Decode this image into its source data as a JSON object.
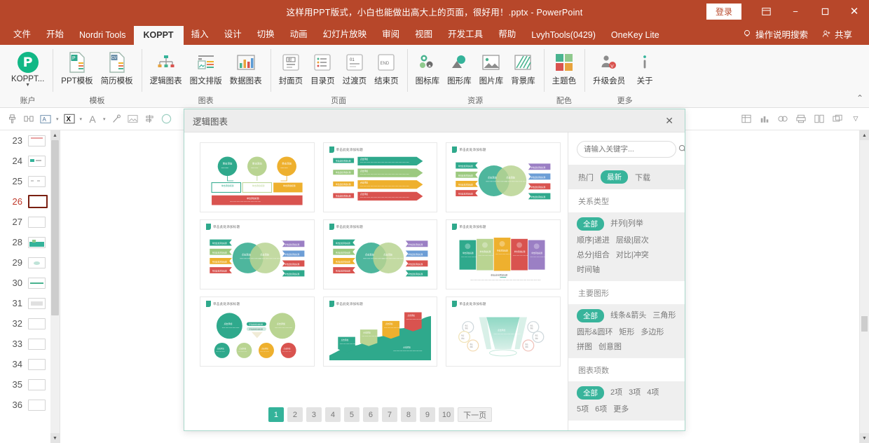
{
  "titlebar": {
    "document_title": "这样用PPT版式，小白也能做出高大上的页面，很好用！.pptx - PowerPoint",
    "signin_label": "登录",
    "restore_icon": "restore-down-icon",
    "minimize_label": "−",
    "maximize_label": "❐",
    "close_label": "✕"
  },
  "ribbon_tabs": {
    "items": [
      {
        "label": "文件",
        "active": false
      },
      {
        "label": "开始",
        "active": false
      },
      {
        "label": "Nordri Tools",
        "active": false
      },
      {
        "label": "KOPPT",
        "active": true
      },
      {
        "label": "插入",
        "active": false
      },
      {
        "label": "设计",
        "active": false
      },
      {
        "label": "切换",
        "active": false
      },
      {
        "label": "动画",
        "active": false
      },
      {
        "label": "幻灯片放映",
        "active": false
      },
      {
        "label": "审阅",
        "active": false
      },
      {
        "label": "视图",
        "active": false
      },
      {
        "label": "开发工具",
        "active": false
      },
      {
        "label": "帮助",
        "active": false
      },
      {
        "label": "LvyhTools(0429)",
        "active": false
      },
      {
        "label": "OneKey Lite",
        "active": false
      }
    ],
    "tell_me": "操作说明搜索",
    "share": "共享"
  },
  "ribbon_groups": [
    {
      "label": "账户",
      "buttons": [
        {
          "label": "KOPPT...",
          "icon": "koppt-logo-icon",
          "caret": true
        }
      ]
    },
    {
      "label": "模板",
      "buttons": [
        {
          "label": "PPT模板",
          "icon": "ppt-template-icon"
        },
        {
          "label": "简历模板",
          "icon": "resume-template-icon"
        }
      ]
    },
    {
      "label": "图表",
      "buttons": [
        {
          "label": "逻辑图表",
          "icon": "logic-chart-icon"
        },
        {
          "label": "图文排版",
          "icon": "text-image-layout-icon"
        },
        {
          "label": "数据图表",
          "icon": "data-chart-icon"
        }
      ]
    },
    {
      "label": "页面",
      "buttons": [
        {
          "label": "封面页",
          "icon": "cover-page-icon"
        },
        {
          "label": "目录页",
          "icon": "toc-page-icon"
        },
        {
          "label": "过渡页",
          "icon": "transition-page-icon"
        },
        {
          "label": "结束页",
          "icon": "end-page-icon"
        }
      ]
    },
    {
      "label": "资源",
      "buttons": [
        {
          "label": "图标库",
          "icon": "icon-library-icon"
        },
        {
          "label": "图形库",
          "icon": "shape-library-icon"
        },
        {
          "label": "图片库",
          "icon": "image-library-icon"
        },
        {
          "label": "背景库",
          "icon": "background-library-icon"
        }
      ]
    },
    {
      "label": "配色",
      "buttons": [
        {
          "label": "主题色",
          "icon": "theme-color-icon"
        }
      ]
    },
    {
      "label": "更多",
      "buttons": [
        {
          "label": "升级会员",
          "icon": "upgrade-member-icon"
        },
        {
          "label": "关于",
          "icon": "about-info-icon"
        }
      ]
    }
  ],
  "quickbar": {
    "items": [
      {
        "icon": "format-painter-icon",
        "glyph": "⎙"
      },
      {
        "icon": "duplicate-icon",
        "glyph": "◫"
      },
      {
        "icon": "text-box-icon",
        "glyph": "A"
      },
      {
        "icon": "clear-format-icon",
        "glyph": "X"
      },
      {
        "icon": "font-color-icon",
        "glyph": "A"
      },
      {
        "icon": "eyedropper-icon",
        "glyph": "✎"
      },
      {
        "icon": "picture-swap-icon",
        "glyph": "▣"
      },
      {
        "icon": "align-icon",
        "glyph": "⇹"
      },
      {
        "icon": "circle-shape-icon",
        "glyph": "◯"
      }
    ],
    "right_items": [
      {
        "icon": "table-icon",
        "glyph": "▦"
      },
      {
        "icon": "chart-bar-icon",
        "glyph": "▥"
      },
      {
        "icon": "smart-art-icon",
        "glyph": "◔"
      },
      {
        "icon": "print-icon",
        "glyph": "⎙"
      },
      {
        "icon": "columns-icon",
        "glyph": "▤"
      },
      {
        "icon": "layers-icon",
        "glyph": "▣"
      },
      {
        "icon": "more-options-icon",
        "glyph": "▽"
      }
    ]
  },
  "slide_panel": {
    "slides": [
      {
        "number": "23",
        "active": false,
        "thumb": "a"
      },
      {
        "number": "24",
        "active": false,
        "thumb": "b"
      },
      {
        "number": "25",
        "active": false,
        "thumb": "c"
      },
      {
        "number": "26",
        "active": true,
        "thumb": "d"
      },
      {
        "number": "27",
        "active": false,
        "thumb": "e"
      },
      {
        "number": "28",
        "active": false,
        "thumb": "f"
      },
      {
        "number": "29",
        "active": false,
        "thumb": "g"
      },
      {
        "number": "30",
        "active": false,
        "thumb": "h"
      },
      {
        "number": "31",
        "active": false,
        "thumb": "i"
      },
      {
        "number": "32",
        "active": false,
        "thumb": "j"
      },
      {
        "number": "33",
        "active": false,
        "thumb": "k"
      },
      {
        "number": "34",
        "active": false,
        "thumb": "l"
      },
      {
        "number": "35",
        "active": false,
        "thumb": "m"
      },
      {
        "number": "36",
        "active": false,
        "thumb": "n"
      }
    ],
    "scroll_up": "▲",
    "scroll_down": "▼"
  },
  "dialog": {
    "title": "逻辑图表",
    "close_label": "✕",
    "search": {
      "placeholder": "请输入关键字...",
      "value": "",
      "icon": "search-icon"
    },
    "sort_tabs": [
      {
        "label": "热门",
        "active": false
      },
      {
        "label": "最新",
        "active": true
      },
      {
        "label": "下载",
        "active": false
      }
    ],
    "filter_sections": [
      {
        "heading": "关系类型",
        "options": [
          {
            "label": "全部",
            "active": true
          },
          {
            "label": "并列|列举",
            "active": false
          },
          {
            "label": "顺序|递进",
            "active": false
          },
          {
            "label": "层级|层次",
            "active": false
          },
          {
            "label": "总分|组合",
            "active": false
          },
          {
            "label": "对比|冲突",
            "active": false
          },
          {
            "label": "时间轴",
            "active": false
          }
        ]
      },
      {
        "heading": "主要图形",
        "options": [
          {
            "label": "全部",
            "active": true
          },
          {
            "label": "线条&箭头",
            "active": false
          },
          {
            "label": "三角形",
            "active": false
          },
          {
            "label": "圆形&圆环",
            "active": false
          },
          {
            "label": "矩形",
            "active": false
          },
          {
            "label": "多边形",
            "active": false
          },
          {
            "label": "拼图",
            "active": false
          },
          {
            "label": "创意图",
            "active": false
          }
        ]
      },
      {
        "heading": "图表项数",
        "options": [
          {
            "label": "全部",
            "active": true
          },
          {
            "label": "2项",
            "active": false
          },
          {
            "label": "3项",
            "active": false
          },
          {
            "label": "4项",
            "active": false
          },
          {
            "label": "5项",
            "active": false
          },
          {
            "label": "6项",
            "active": false
          },
          {
            "label": "更多",
            "active": false
          }
        ]
      }
    ],
    "cards": [
      {
        "name": "card-flow-circles-boxes",
        "caption": "",
        "layout": "flow3"
      },
      {
        "name": "card-arrow-bars",
        "caption": "单击此处添加标题",
        "layout": "arrows4"
      },
      {
        "name": "card-venn-banners",
        "caption": "单击此处添加标题",
        "layout": "venn-side"
      },
      {
        "name": "card-venn-banners-2",
        "caption": "单击此处添加标题",
        "layout": "venn-side2"
      },
      {
        "name": "card-venn-banners-3",
        "caption": "单击此处添加标题",
        "layout": "venn-side3"
      },
      {
        "name": "card-curved-panels",
        "caption": "单击此处添加标题",
        "layout": "panels5"
      },
      {
        "name": "card-circle-cluster",
        "caption": "单击此处添加标题",
        "layout": "circles"
      },
      {
        "name": "card-area-growth",
        "caption": "单击此处添加标题",
        "layout": "area"
      },
      {
        "name": "card-funnel",
        "caption": "单击此处添加标题",
        "layout": "funnel"
      }
    ],
    "pagination": {
      "pages": [
        "1",
        "2",
        "3",
        "4",
        "5",
        "6",
        "7",
        "8",
        "9",
        "10"
      ],
      "current": "1",
      "next_label": "下一页"
    }
  },
  "colors": {
    "ribbon_red": "#b7472a",
    "accent_teal": "#34b39a",
    "koppt_green": "#12b886",
    "active_slide_border": "#7a1f11"
  }
}
